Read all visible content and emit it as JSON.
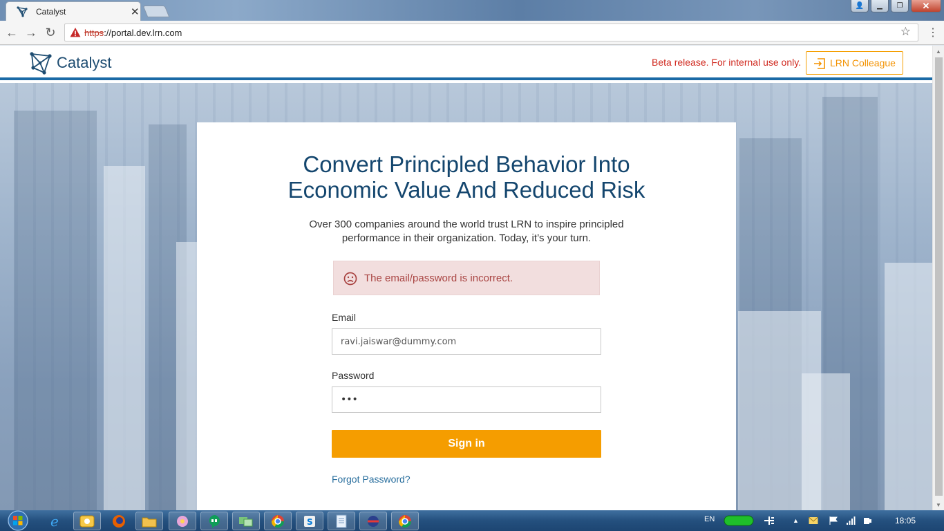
{
  "browser": {
    "tab_title": "Catalyst",
    "url_scheme": "https",
    "url_rest": "://portal.dev.lrn.com"
  },
  "header": {
    "logo_text": "Catalyst",
    "beta_notice": "Beta release. For internal use only.",
    "colleague_button": "LRN Colleague"
  },
  "login": {
    "headline_line1": "Convert Principled Behavior Into",
    "headline_line2": "Economic Value And Reduced Risk",
    "subtitle_line1": "Over 300 companies around the world trust LRN to inspire principled",
    "subtitle_line2": "performance in their organization. Today, it’s your turn.",
    "error_message": "The email/password is incorrect.",
    "email_label": "Email",
    "email_value": "ravi.jaiswar@dummy.com",
    "password_label": "Password",
    "password_value": "•••",
    "signin_button": "Sign in",
    "forgot_link": "Forgot Password?"
  },
  "colors": {
    "brand_blue": "#14466e",
    "accent_orange": "#f59d00",
    "error_red": "#a94442",
    "beta_red": "#d0281e"
  },
  "taskbar": {
    "language": "EN",
    "clock": "18:05"
  }
}
